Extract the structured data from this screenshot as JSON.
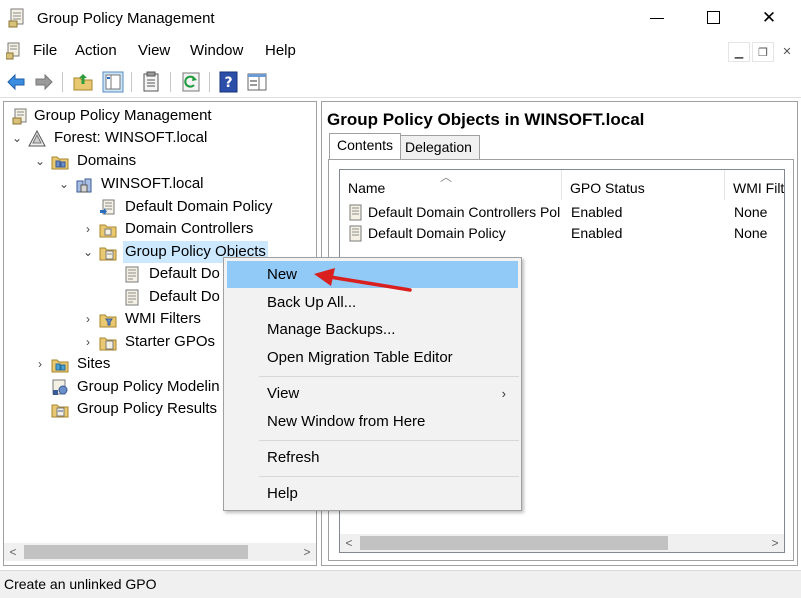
{
  "window": {
    "title": "Group Policy Management",
    "minimize_icon": "minimize-icon",
    "maximize_icon": "maximize-icon",
    "close_glyph": "✕"
  },
  "menubar": {
    "items": [
      "File",
      "Action",
      "View",
      "Window",
      "Help"
    ]
  },
  "tree": {
    "nodes": [
      {
        "label": "Group Policy Management",
        "expander": "",
        "icon": "gpm-console-icon"
      },
      {
        "label": "Forest: WINSOFT.local",
        "expander": "⌄",
        "icon": "forest-icon"
      },
      {
        "label": "Domains",
        "expander": "⌄",
        "icon": "domains-folder-icon"
      },
      {
        "label": "WINSOFT.local",
        "expander": "⌄",
        "icon": "domain-icon"
      },
      {
        "label": "Default Domain Policy",
        "expander": "",
        "icon": "gpo-link-icon"
      },
      {
        "label": "Domain Controllers",
        "expander": "›",
        "icon": "ou-folder-icon"
      },
      {
        "label": "Group Policy Objects",
        "expander": "⌄",
        "icon": "gpo-folder-icon"
      },
      {
        "label": "Default Do",
        "expander": "",
        "icon": "gpo-icon"
      },
      {
        "label": "Default Do",
        "expander": "",
        "icon": "gpo-icon"
      },
      {
        "label": "WMI Filters",
        "expander": "›",
        "icon": "wmi-folder-icon"
      },
      {
        "label": "Starter GPOs",
        "expander": "›",
        "icon": "starter-folder-icon"
      },
      {
        "label": "Sites",
        "expander": "›",
        "icon": "sites-folder-icon"
      },
      {
        "label": "Group Policy Modelin",
        "expander": "",
        "icon": "modeling-icon"
      },
      {
        "label": "Group Policy Results",
        "expander": "",
        "icon": "results-icon"
      }
    ]
  },
  "right_pane": {
    "title": "Group Policy Objects in WINSOFT.local",
    "tabs": [
      "Contents",
      "Delegation"
    ],
    "columns": [
      "Name",
      "GPO Status",
      "WMI Filt"
    ],
    "rows": [
      {
        "name": "Default Domain Controllers Poli...",
        "status": "Enabled",
        "wmi": "None"
      },
      {
        "name": "Default Domain Policy",
        "status": "Enabled",
        "wmi": "None"
      }
    ]
  },
  "context_menu": {
    "items": [
      {
        "label": "New"
      },
      {
        "label": "Back Up All..."
      },
      {
        "label": "Manage Backups..."
      },
      {
        "label": "Open Migration Table Editor"
      },
      {
        "label": "View"
      },
      {
        "label": "New Window from Here"
      },
      {
        "label": "Refresh"
      },
      {
        "label": "Help"
      }
    ],
    "submenu_glyph": "›"
  },
  "status_bar": {
    "text": "Create an unlinked GPO"
  },
  "colors": {
    "highlight": "#91c9f7",
    "selection": "#cce8ff",
    "annotation_arrow": "#d9201f"
  }
}
